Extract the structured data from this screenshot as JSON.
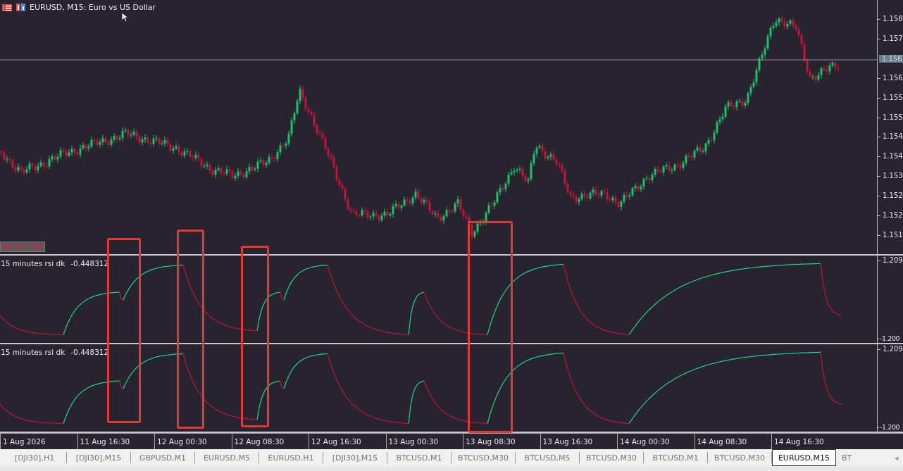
{
  "chart": {
    "symbol_title": "EURUSD, M15:  Euro vs US Dollar",
    "panel_button": "Panel: OFF",
    "current_price": "1.156",
    "price_ticks": [
      "1.158",
      "1.157",
      "1.156",
      "1.155",
      "1.155",
      "1.154",
      "1.154",
      "1.153",
      "1.152",
      "1.152",
      "1.151"
    ]
  },
  "indicators": [
    {
      "name": "15 minutes rsi dk",
      "value": "-0.448312",
      "top_tick": "1.209",
      "bottom_tick": "-1.200"
    },
    {
      "name": "15 minutes rsi dk",
      "value": "-0.448312",
      "top_tick": "1.209",
      "bottom_tick": "-1.200"
    }
  ],
  "time_axis": [
    "1 Aug 2026",
    "11 Aug 16:30",
    "12 Aug 00:30",
    "12 Aug 08:30",
    "12 Aug 16:30",
    "13 Aug 00:30",
    "13 Aug 08:30",
    "13 Aug 16:30",
    "14 Aug 00:30",
    "14 Aug 08:30",
    "14 Aug 16:30"
  ],
  "tabs": [
    {
      "label": "[DJI30],H1",
      "selected": false
    },
    {
      "label": "[DJI30],M15",
      "selected": false
    },
    {
      "label": "GBPUSD,M1",
      "selected": false
    },
    {
      "label": "EURUSD,M5",
      "selected": false
    },
    {
      "label": "EURUSD,H1",
      "selected": false
    },
    {
      "label": "[DJI30],M15",
      "selected": false
    },
    {
      "label": "BTCUSD,M1",
      "selected": false
    },
    {
      "label": "BTCUSD,M30",
      "selected": false
    },
    {
      "label": "BTCUSD,M5",
      "selected": false
    },
    {
      "label": "BTCUSD,M30",
      "selected": false
    },
    {
      "label": "BTCUSD,M1",
      "selected": false
    },
    {
      "label": "BTCUSD,M30",
      "selected": false
    },
    {
      "label": "EURUSD,M15",
      "selected": true
    },
    {
      "label": "BT",
      "selected": false
    }
  ],
  "tab_scroll": "◂"
}
